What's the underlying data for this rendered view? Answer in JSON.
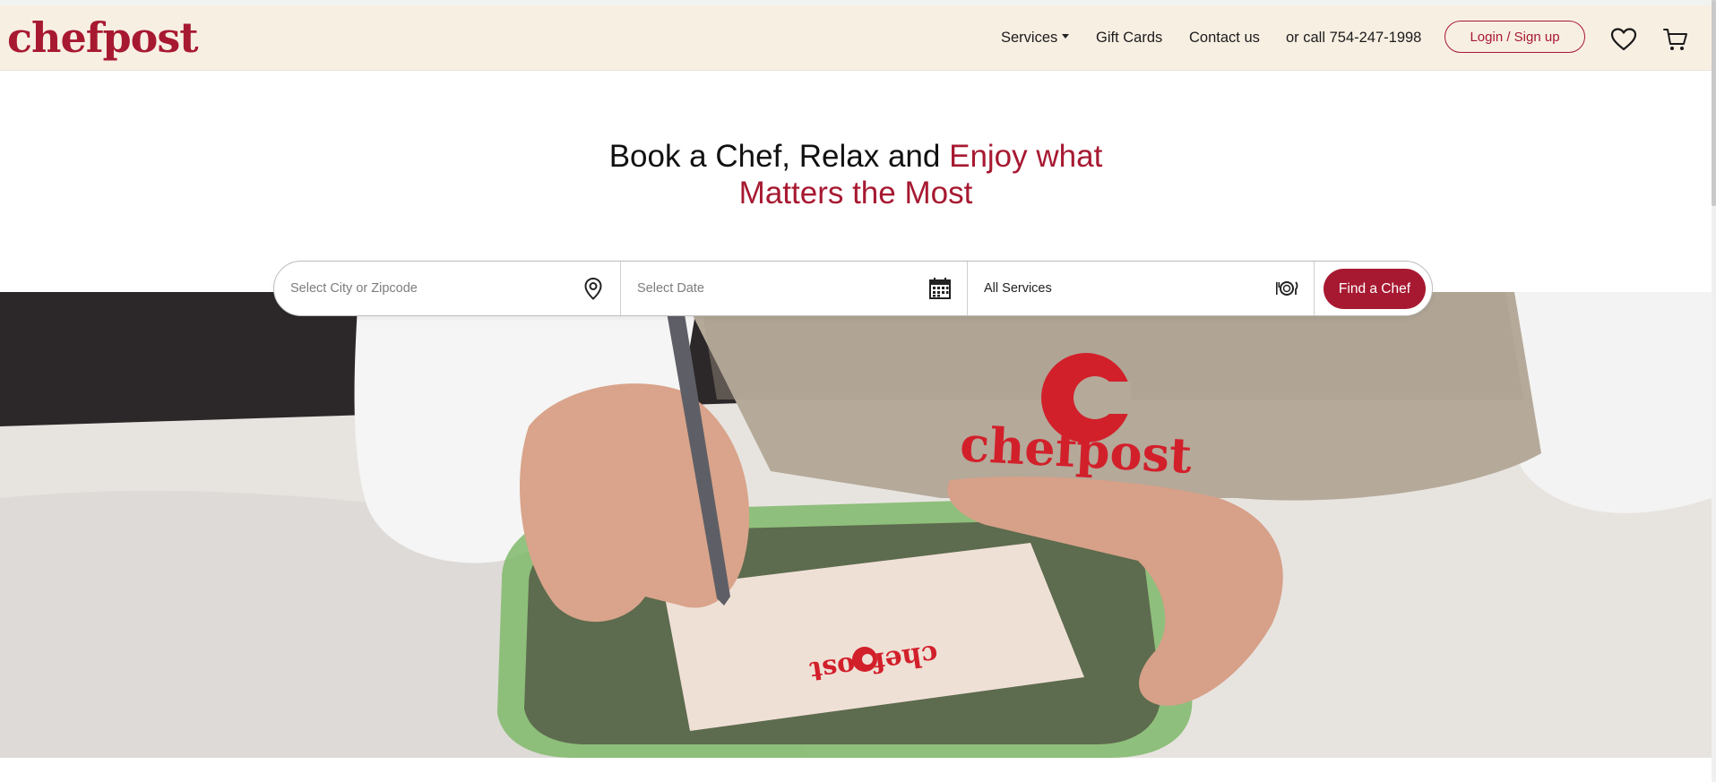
{
  "brand": {
    "logo_text": "chefpost",
    "accent_color": "#a71931",
    "header_bg": "#f8efe3"
  },
  "nav": {
    "services_label": "Services",
    "gift_cards_label": "Gift Cards",
    "contact_label": "Contact us",
    "call_label": "or call 754-247-1998",
    "login_label": "Login / Sign up",
    "icons": [
      "heart-icon",
      "cart-icon",
      "chevron-down-icon"
    ]
  },
  "hero": {
    "title_plain": "Book a Chef, Relax and ",
    "title_accent_1": "Enjoy what",
    "title_accent_2": "Matters the Most"
  },
  "search": {
    "city_placeholder": "Select City or Zipcode",
    "date_placeholder": "Select Date",
    "service_value": "All Services",
    "find_label": "Find a Chef",
    "icons": [
      "location-pin-icon",
      "calendar-icon",
      "plate-cutlery-icon"
    ]
  },
  "image": {
    "apron_logo_text": "chefpost",
    "label_logo_text": "chefpost"
  }
}
